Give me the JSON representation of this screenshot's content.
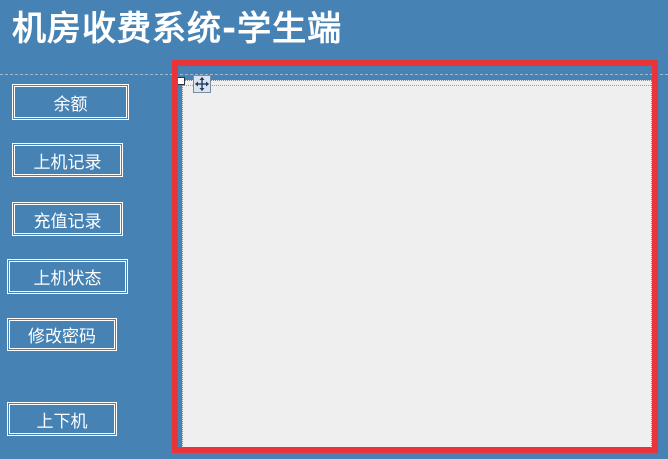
{
  "app": {
    "title": "机房收费系统-学生端"
  },
  "nav": {
    "balance": "余额",
    "login_records": "上机记录",
    "recharge_records": "充值记录",
    "machine_status": "上机状态",
    "change_password": "修改密码",
    "toggle_machine": "上下机"
  },
  "colors": {
    "background": "#4682b4",
    "highlight_frame": "#e8343a",
    "content_panel": "#efefef",
    "text": "#ffffff"
  },
  "icons": {
    "move_handle": "move-icon"
  }
}
